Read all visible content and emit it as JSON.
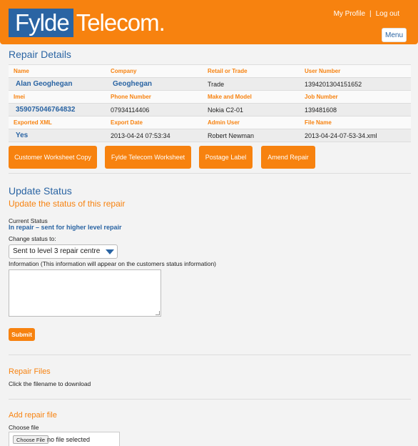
{
  "header": {
    "logo_part1": "Fylde",
    "logo_part2": "Telecom.",
    "my_profile": "My Profile",
    "separator": "|",
    "logout": "Log out",
    "menu": "Menu"
  },
  "repair_details": {
    "title": "Repair Details",
    "rows": [
      {
        "labels": [
          "Name",
          "Company",
          "Retail or Trade",
          "User Number"
        ],
        "values": [
          "Alan Geoghegan",
          "Geoghegan",
          "Trade",
          "1394201304151652"
        ]
      },
      {
        "labels": [
          "Imei",
          "Phone Number",
          "Make and Model",
          "Job Number"
        ],
        "values": [
          "359075046764832",
          "07934114406",
          "Nokia C2-01",
          "139481608"
        ]
      },
      {
        "labels": [
          "Exported XML",
          "Export Date",
          "Admin User",
          "File Name"
        ],
        "values": [
          "Yes",
          "2013-04-24 07:53:34",
          "Robert Newman",
          "2013-04-24-07-53-34.xml"
        ]
      }
    ],
    "buttons": [
      "Customer Worksheet Copy",
      "Fylde Telecom Worksheet",
      "Postage Label",
      "Amend Repair"
    ]
  },
  "update_status": {
    "title": "Update Status",
    "subtitle": "Update the status of this repair",
    "current_label": "Current Status",
    "current_value": "In repair – sent for higher level repair",
    "change_label": "Change status to:",
    "selected_option": "Sent to level 3 repair centre",
    "info_label": "Information (This information will appear on the customers status information)",
    "info_value": "",
    "submit": "Submit"
  },
  "repair_files": {
    "title": "Repair Files",
    "hint": "Click the filename to download"
  },
  "add_file": {
    "title": "Add repair file",
    "choose_label": "Choose file",
    "choose_button": "Choose File",
    "no_file": "no file selected"
  },
  "colors": {
    "accent": "#f7820f",
    "brand_blue": "#2a64a3"
  }
}
